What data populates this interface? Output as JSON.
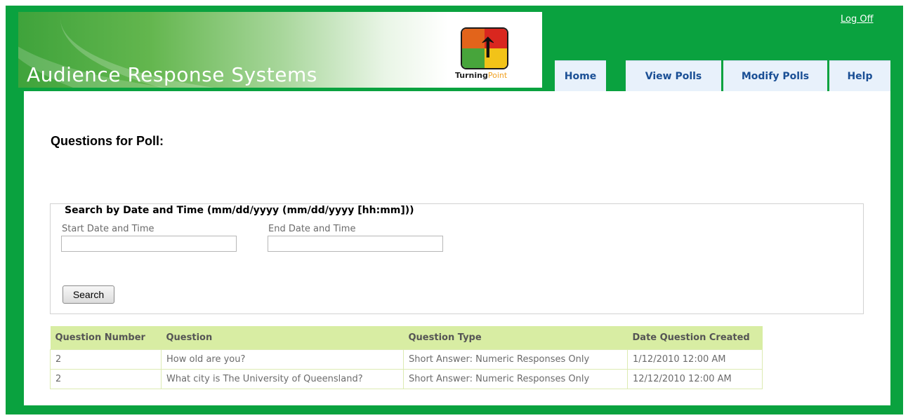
{
  "header": {
    "app_title": "Audience Response Systems",
    "logo_brand_bold": "Turning",
    "logo_brand_light": "Point",
    "log_off": "Log Off"
  },
  "nav": {
    "tabs": [
      {
        "label": "Home"
      },
      {
        "label": "View Polls"
      },
      {
        "label": "Modify Polls"
      },
      {
        "label": "Help"
      }
    ]
  },
  "page": {
    "title": "Questions for Poll:"
  },
  "search": {
    "legend": "Search by Date and Time (mm/dd/yyyy (mm/dd/yyyy [hh:mm]))",
    "start_label": "Start Date and Time",
    "start_value": "",
    "end_label": "End Date and Time",
    "end_value": "",
    "button_label": "Search"
  },
  "table": {
    "headers": [
      "Question Number",
      "Question",
      "Question Type",
      "Date Question Created"
    ],
    "rows": [
      [
        "2",
        "How old are you?",
        "Short Answer: Numeric Responses Only",
        "1/12/2010 12:00 AM"
      ],
      [
        "2",
        "What city is The University of Queensland?",
        "Short Answer: Numeric Responses Only",
        "12/12/2010 12:00 AM"
      ]
    ]
  },
  "colors": {
    "frame_green": "#0aa23f",
    "tab_background": "#e8f1fb",
    "tab_text": "#1a4f95",
    "table_header": "#d8eda3"
  }
}
